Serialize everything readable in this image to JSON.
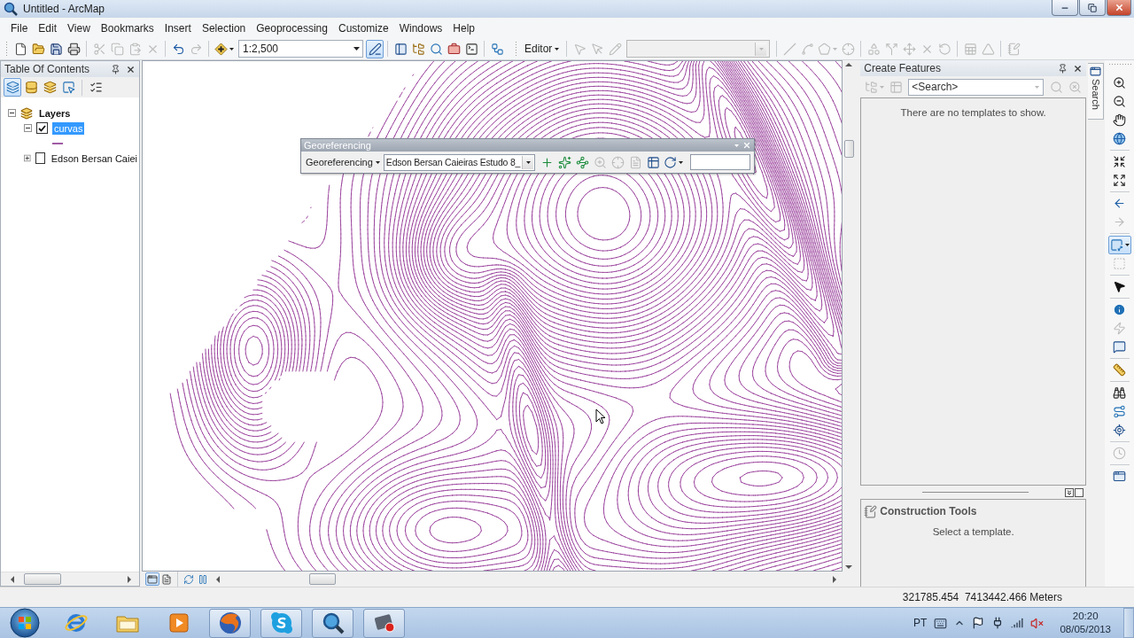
{
  "window": {
    "title": "Untitled - ArcMap"
  },
  "menu": [
    "File",
    "Edit",
    "View",
    "Bookmarks",
    "Insert",
    "Selection",
    "Geoprocessing",
    "Customize",
    "Windows",
    "Help"
  ],
  "standard_toolbar": {
    "left": [
      [
        {
          "kind": "new",
          "disabled": false,
          "pressed": false
        },
        {
          "kind": "open",
          "disabled": false,
          "pressed": false
        },
        {
          "kind": "save",
          "disabled": false,
          "pressed": false
        },
        {
          "kind": "print",
          "disabled": false,
          "pressed": false
        }
      ],
      [
        {
          "kind": "cut",
          "disabled": true,
          "pressed": false
        },
        {
          "kind": "copy",
          "disabled": true,
          "pressed": false
        },
        {
          "kind": "paste",
          "disabled": true,
          "pressed": false
        },
        {
          "kind": "delete",
          "disabled": true,
          "pressed": false
        }
      ],
      [
        {
          "kind": "undo",
          "disabled": false,
          "pressed": false
        },
        {
          "kind": "redo",
          "disabled": true,
          "pressed": false
        }
      ],
      [
        {
          "kind": "add_data",
          "disabled": false,
          "pressed": false
        }
      ]
    ],
    "scale": "1:2,500",
    "right": [
      [
        {
          "kind": "editor_toolbar",
          "disabled": false,
          "pressed": true
        }
      ],
      [
        {
          "kind": "toc_window",
          "disabled": false,
          "pressed": false
        },
        {
          "kind": "catalog_window",
          "disabled": false,
          "pressed": false
        },
        {
          "kind": "search_window",
          "disabled": false,
          "pressed": false
        },
        {
          "kind": "arctoolbox",
          "disabled": false,
          "pressed": false
        },
        {
          "kind": "python",
          "disabled": false,
          "pressed": false
        }
      ],
      [
        {
          "kind": "model_builder",
          "disabled": false,
          "pressed": false
        }
      ]
    ]
  },
  "editor_toolbar": {
    "menu": "Editor",
    "left": [
      [
        {
          "kind": "edit_tool",
          "disabled": true,
          "pressed": false
        },
        {
          "kind": "edit_annotation",
          "disabled": true,
          "pressed": false
        },
        {
          "kind": "sketch",
          "disabled": true,
          "pressed": false
        }
      ]
    ],
    "target": {
      "disabled": true
    },
    "right": [
      [
        {
          "kind": "straight_segment",
          "disabled": true,
          "pressed": false
        },
        {
          "kind": "endpoint_arc",
          "disabled": true,
          "pressed": false
        },
        {
          "kind": "construction",
          "disabled": true,
          "pressed": false
        },
        {
          "kind": "midpoint",
          "disabled": true,
          "pressed": false
        }
      ],
      [
        {
          "kind": "reshape",
          "disabled": true,
          "pressed": false
        },
        {
          "kind": "cut_polygons",
          "disabled": true,
          "pressed": false
        },
        {
          "kind": "split",
          "disabled": true,
          "pressed": false
        },
        {
          "kind": "delete_vertex",
          "disabled": true,
          "pressed": false
        },
        {
          "kind": "rotate_feature",
          "disabled": true,
          "pressed": false
        }
      ],
      [
        {
          "kind": "attributes",
          "disabled": true,
          "pressed": false
        },
        {
          "kind": "sketch_properties",
          "disabled": true,
          "pressed": false
        }
      ],
      [
        {
          "kind": "create_features",
          "disabled": true,
          "pressed": false
        }
      ]
    ]
  },
  "toc": {
    "title": "Table Of Contents",
    "tools": [
      [
        {
          "kind": "list_by_drawing_order",
          "disabled": false,
          "pressed": true
        },
        {
          "kind": "list_by_source",
          "disabled": false,
          "pressed": false
        },
        {
          "kind": "list_by_visibility",
          "disabled": false,
          "pressed": false
        },
        {
          "kind": "list_by_selection",
          "disabled": false,
          "pressed": false
        }
      ],
      [
        {
          "kind": "options",
          "disabled": false,
          "pressed": false
        }
      ]
    ],
    "layers": [
      {
        "name": "Layers",
        "expanded": true,
        "children": [
          {
            "name": "curvas",
            "checked": true,
            "selected": true,
            "expanded": true
          },
          {
            "name": "Edson Bersan Caiei",
            "checked": false,
            "selected": false,
            "expanded": false
          }
        ]
      }
    ]
  },
  "map": {
    "view_buttons": [
      [
        {
          "kind": "data_view",
          "disabled": false,
          "pressed": true
        },
        {
          "kind": "layout_view",
          "disabled": false,
          "pressed": false
        }
      ],
      [
        {
          "kind": "refresh",
          "disabled": false,
          "pressed": false
        },
        {
          "kind": "pause",
          "disabled": false,
          "pressed": false
        }
      ]
    ]
  },
  "georeferencing": {
    "title": "Georeferencing",
    "menu": "Georeferencing",
    "layer": "Edson Bersan Caieiras Estudo 8_",
    "tools": [
      [
        {
          "kind": "add_control_points",
          "disabled": false,
          "pressed": false
        },
        {
          "kind": "auto_registration",
          "disabled": false,
          "pressed": false
        },
        {
          "kind": "select_link",
          "disabled": false,
          "pressed": false
        },
        {
          "kind": "zoom_to_link",
          "disabled": true,
          "pressed": false
        },
        {
          "kind": "delete_link",
          "disabled": true,
          "pressed": false
        },
        {
          "kind": "link_report",
          "disabled": true,
          "pressed": false
        },
        {
          "kind": "view_link_table",
          "disabled": false,
          "pressed": false
        },
        {
          "kind": "rotate",
          "disabled": false,
          "pressed": false
        }
      ]
    ]
  },
  "create_features": {
    "title": "Create Features",
    "tools": [
      [
        {
          "kind": "organize_templates",
          "disabled": true,
          "pressed": false
        },
        {
          "kind": "manage_templates",
          "disabled": true,
          "pressed": false
        }
      ]
    ],
    "search_placeholder": "<Search>",
    "search_tools": [
      [
        {
          "kind": "search",
          "disabled": true,
          "pressed": false
        },
        {
          "kind": "clear_search",
          "disabled": true,
          "pressed": false
        }
      ]
    ],
    "message": "There are no templates to show."
  },
  "construction_tools": {
    "title": "Construction Tools",
    "message": "Select a template."
  },
  "search_tab": {
    "label": "Search"
  },
  "tools_toolbar": [
    [
      {
        "kind": "zoom_in",
        "disabled": false,
        "pressed": false
      },
      {
        "kind": "zoom_out",
        "disabled": false,
        "pressed": false
      },
      {
        "kind": "pan",
        "disabled": false,
        "pressed": false
      },
      {
        "kind": "full_extent",
        "disabled": false,
        "pressed": false
      }
    ],
    [
      {
        "kind": "fixed_zoom_in",
        "disabled": false,
        "pressed": false
      },
      {
        "kind": "fixed_zoom_out",
        "disabled": false,
        "pressed": false
      }
    ],
    [
      {
        "kind": "back",
        "disabled": false,
        "pressed": false
      },
      {
        "kind": "forward",
        "disabled": true,
        "pressed": false
      }
    ],
    [
      {
        "kind": "select_features",
        "disabled": false,
        "pressed": true
      },
      {
        "kind": "clear_selection",
        "disabled": true,
        "pressed": false
      }
    ],
    [
      {
        "kind": "select_elements",
        "disabled": false,
        "pressed": false
      }
    ],
    [
      {
        "kind": "identify",
        "disabled": false,
        "pressed": false
      },
      {
        "kind": "hyperlink",
        "disabled": true,
        "pressed": false
      },
      {
        "kind": "html_popup",
        "disabled": false,
        "pressed": false
      }
    ],
    [
      {
        "kind": "measure",
        "disabled": false,
        "pressed": false
      }
    ],
    [
      {
        "kind": "find",
        "disabled": false,
        "pressed": false
      },
      {
        "kind": "find_route",
        "disabled": false,
        "pressed": false
      },
      {
        "kind": "go_to_xy",
        "disabled": false,
        "pressed": false
      }
    ],
    [
      {
        "kind": "time_slider",
        "disabled": true,
        "pressed": false
      }
    ],
    [
      {
        "kind": "viewer_window",
        "disabled": false,
        "pressed": false
      }
    ]
  ],
  "status_bar": {
    "coordinates": "321785.454  7413442.466 Meters"
  },
  "taskbar": {
    "apps": [
      {
        "kind": "ring",
        "running": false
      },
      {
        "kind": "folder",
        "running": false
      },
      {
        "kind": "player",
        "running": false
      },
      {
        "kind": "globe",
        "running": true
      },
      {
        "kind": "bubble",
        "running": true
      },
      {
        "kind": "magnifier",
        "running": true
      },
      {
        "kind": "recorder",
        "running": true
      }
    ],
    "language": "PT",
    "time": "20:20",
    "date": "08/05/2013"
  }
}
